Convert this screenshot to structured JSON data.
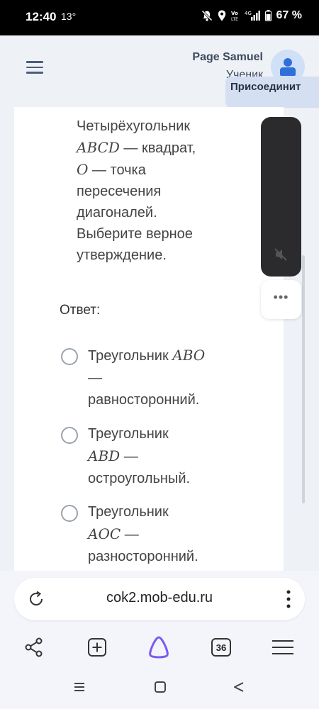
{
  "status_bar": {
    "time": "12:40",
    "temperature": "13°",
    "battery": "67 %"
  },
  "header": {
    "user_name": "Page Samuel",
    "user_role": "Ученик",
    "join_label": "Присоединит"
  },
  "question": {
    "lines": [
      {
        "parts": [
          {
            "t": "Четырёхугольник"
          }
        ]
      },
      {
        "parts": [
          {
            "m": "ABCD"
          },
          {
            "t": " — квадрат,"
          }
        ]
      },
      {
        "parts": [
          {
            "m": "O"
          },
          {
            "t": " — точка"
          }
        ]
      },
      {
        "parts": [
          {
            "t": "пересечения"
          }
        ]
      },
      {
        "parts": [
          {
            "t": "диагоналей."
          }
        ]
      },
      {
        "parts": [
          {
            "t": "Выберите верное"
          }
        ]
      },
      {
        "parts": [
          {
            "t": "утверждение."
          }
        ]
      }
    ]
  },
  "answer_label": "Ответ:",
  "options": [
    {
      "lines": [
        {
          "parts": [
            {
              "t": "Треугольник "
            },
            {
              "m": "ABO"
            }
          ]
        },
        {
          "parts": [
            {
              "t": "—"
            }
          ]
        },
        {
          "parts": [
            {
              "t": "равносторонний."
            }
          ]
        }
      ]
    },
    {
      "lines": [
        {
          "parts": [
            {
              "t": "Треугольник"
            }
          ]
        },
        {
          "parts": [
            {
              "m": "ABD"
            },
            {
              "t": " —"
            }
          ]
        },
        {
          "parts": [
            {
              "t": "остроугольный."
            }
          ]
        }
      ]
    },
    {
      "lines": [
        {
          "parts": [
            {
              "t": "Треугольник"
            }
          ]
        },
        {
          "parts": [
            {
              "m": "AOC"
            },
            {
              "t": " —"
            }
          ]
        },
        {
          "parts": [
            {
              "t": "разносторонний."
            }
          ]
        }
      ]
    }
  ],
  "browser": {
    "url": "cok2.mob-edu.ru",
    "tab_count": "36"
  },
  "colors": {
    "radio_border": "#9aa3ad",
    "assistant_purple": "#7b5cf0",
    "avatar_blue": "#2f6fd8"
  }
}
